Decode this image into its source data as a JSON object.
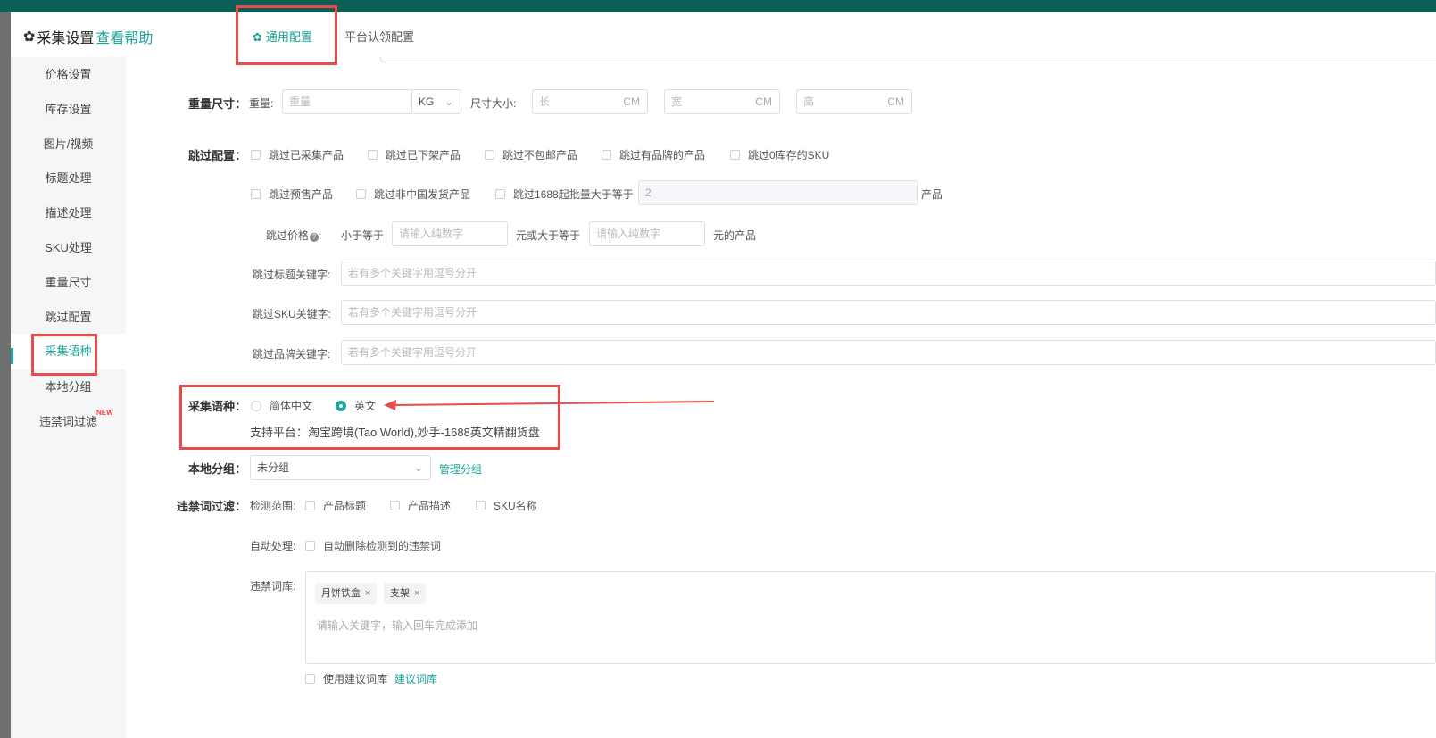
{
  "dialog": {
    "title": "采集设置",
    "help_link": "查看帮助",
    "tabs": [
      "通用配置",
      "平台认领配置"
    ]
  },
  "sidebar": {
    "items": [
      "价格设置",
      "库存设置",
      "图片/视频",
      "标题处理",
      "描述处理",
      "SKU处理",
      "重量尺寸",
      "跳过配置",
      "采集语种",
      "本地分组",
      "违禁词过滤"
    ],
    "active": "采集语种",
    "new_badge": "NEW"
  },
  "weight_size": {
    "label": "重量尺寸：",
    "weight_label": "重量:",
    "weight_placeholder": "重量",
    "weight_unit": "KG",
    "size_label": "尺寸大小:",
    "length_placeholder": "长",
    "width_placeholder": "宽",
    "height_placeholder": "高",
    "size_unit": "CM"
  },
  "skip_config": {
    "label": "跳过配置：",
    "options_row1": [
      "跳过已采集产品",
      "跳过已下架产品",
      "跳过不包邮产品",
      "跳过有品牌的产品",
      "跳过0库存的SKU"
    ],
    "options_row2": [
      "跳过预售产品",
      "跳过非中国发货产品",
      "跳过1688起批量大于等于"
    ],
    "min_batch_value": "2",
    "min_batch_suffix": "产品",
    "price_label": "跳过价格",
    "price_lte": "小于等于",
    "price_placeholder": "请输入纯数字",
    "price_or_gte": "元或大于等于",
    "price_suffix": "元的产品",
    "title_kw_label": "跳过标题关键字:",
    "sku_kw_label": "跳过SKU关键字:",
    "brand_kw_label": "跳过品牌关键字:",
    "kw_placeholder": "若有多个关键字用逗号分开"
  },
  "language": {
    "label": "采集语种：",
    "options": [
      "简体中文",
      "英文"
    ],
    "selected": "英文",
    "support_text": "支持平台：淘宝跨境(Tao World),妙手-1688英文精翻货盘"
  },
  "local_group": {
    "label": "本地分组：",
    "value": "未分组",
    "manage_link": "管理分组"
  },
  "forbidden": {
    "label": "违禁词过滤：",
    "scope_label": "检测范围:",
    "scope_options": [
      "产品标题",
      "产品描述",
      "SKU名称"
    ],
    "auto_label": "自动处理:",
    "auto_option": "自动删除检测到的违禁词",
    "lib_label": "违禁词库:",
    "tags": [
      "月饼铁盒",
      "支架"
    ],
    "input_placeholder": "请输入关键字，输入回车完成添加",
    "use_suggested": "使用建议词库",
    "suggested_link": "建议词库"
  },
  "colors": {
    "accent": "#1aa59a",
    "annotation_red": "#e94b4b"
  }
}
